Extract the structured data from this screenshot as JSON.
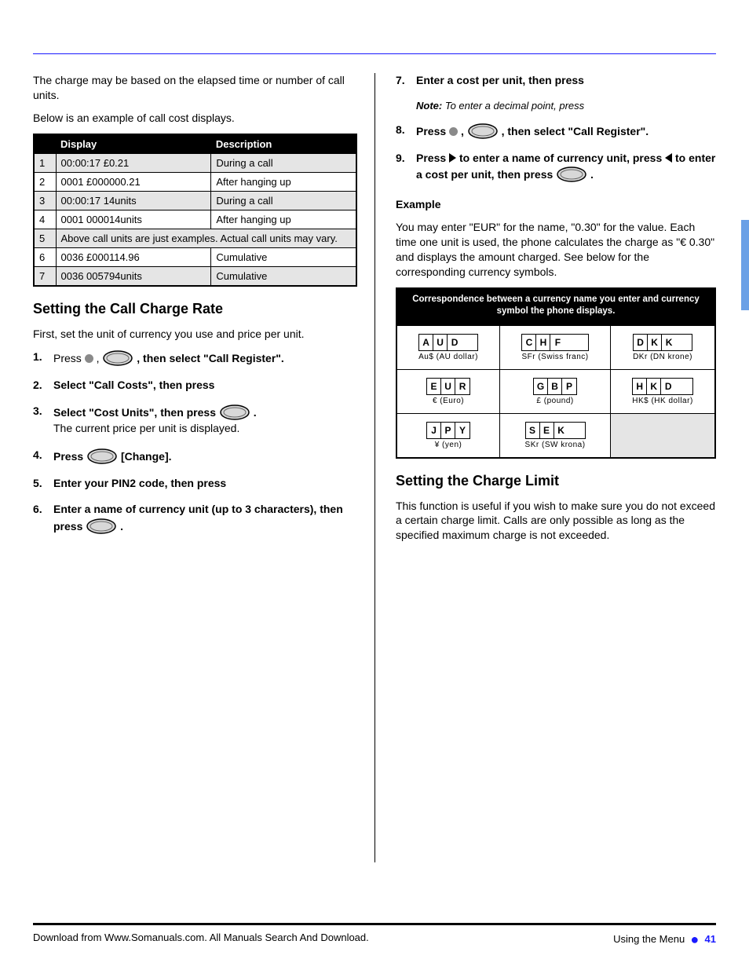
{
  "left": {
    "intro1": "The charge may be based on the elapsed time or number of call units.",
    "intro2": "Below is an example of call cost displays.",
    "table": {
      "headers": [
        "Display",
        "Description"
      ],
      "rows": [
        {
          "n": "1",
          "c1": "00:00:17 £0.21",
          "c2": "During a call"
        },
        {
          "n": "2",
          "c1": "0001 £000000.21",
          "c2": "After hanging up"
        },
        {
          "n": "3",
          "c1": "00:00:17 14units",
          "c2": "During a call"
        },
        {
          "n": "4",
          "c1": "0001 000014units",
          "c2": "After hanging up"
        },
        {
          "n": "5",
          "c1": "Above call units are just examples. Actual call units may vary.",
          "span": true
        },
        {
          "n": "6",
          "c1": "0036 £000114.96",
          "c2": "Cumulative"
        },
        {
          "n": "7",
          "c1": "0036 005794units",
          "c2": "Cumulative"
        }
      ]
    },
    "heading": "Setting the Call Charge Rate",
    "desc": "First, set the unit of currency you use and price per unit.",
    "steps": [
      {
        "num": "1.",
        "pre": "Press ",
        "dot": true,
        "mid": ", ",
        "oval": true,
        "post": ", then select \"Call Register\"."
      },
      {
        "num": "2.",
        "plain": "Select \"Call Costs\", then press "
      },
      {
        "num": "3.",
        "pre": "Select \"Cost Units\", then press ",
        "oval": true,
        "post": ".",
        "extra": "The current price per unit is displayed."
      },
      {
        "num": "4.",
        "pre": "Press ",
        "oval": true,
        "post": " [Change]."
      },
      {
        "num": "5.",
        "plain": "Enter your PIN2 code, then press"
      },
      {
        "num": "6.",
        "pre": "Enter a name of currency unit (up to 3 characters), then press ",
        "oval": true,
        "post": "."
      }
    ]
  },
  "right": {
    "steps": [
      {
        "num": "7.",
        "text": "Enter a cost per unit, then press",
        "note_label": "Note:",
        "note": "To enter a decimal point, press"
      },
      {
        "num": "8.",
        "pre": "Press ",
        "dot": true,
        "mid": ", ",
        "oval": true,
        "post": ", then select \"Call Register\"."
      },
      {
        "num": "9.",
        "pre": "Press ",
        "tri_r": true,
        "mid": " to enter a name of currency unit, press ",
        "tri_l": true,
        "mid2": " to enter a cost per unit, then press ",
        "oval": true,
        "post": "."
      }
    ],
    "ex_label": "Example",
    "ex_text": "You may enter \"EUR\" for the name, \"0.30\" for the value. Each time one unit is used, the phone calculates the charge as \"€ 0.30\" and displays the amount charged. See below for the corresponding currency symbols.",
    "table": {
      "header": "Correspondence between a currency name you enter and currency symbol the phone displays.",
      "cells": [
        {
          "top": [
            "A",
            "U",
            "D"
          ],
          "bot": "Au$ (AU dollar)"
        },
        {
          "top": [
            "C",
            "H",
            "F"
          ],
          "bot": "SFr (Swiss franc)"
        },
        {
          "top": [
            "D",
            "K",
            "K"
          ],
          "bot": "DKr (DN krone)"
        },
        {
          "top": [
            "E",
            "U",
            "R"
          ],
          "bot": "€ (Euro)"
        },
        {
          "top": [
            "G",
            "B",
            "P"
          ],
          "bot": "£ (pound)"
        },
        {
          "top": [
            "H",
            "K",
            "D"
          ],
          "bot": "HK$ (HK dollar)"
        },
        {
          "top": [
            "J",
            "P",
            "Y"
          ],
          "bot": "¥ (yen)"
        },
        {
          "top": [
            "S",
            "E",
            "K"
          ],
          "bot": "SKr (SW krona)"
        },
        {
          "shade": true
        }
      ]
    },
    "heading2": "Setting the Charge Limit",
    "desc2": "This function is useful if you wish to make sure you do not exceed a certain charge limit. Calls are only possible as long as the specified maximum charge is not exceeded."
  },
  "footer": {
    "left": "Download from Www.Somanuals.com. All Manuals Search And Download.",
    "right_label": "Using the Menu",
    "page": "41"
  }
}
